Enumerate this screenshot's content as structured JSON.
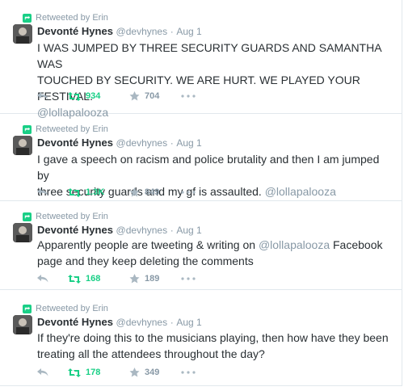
{
  "tweets": [
    {
      "retweeted_by": "Retweeted by Erin",
      "name": "Devonté Hynes",
      "handle": "@devhynes",
      "time": "Aug 1",
      "lines": [
        "I WAS JUMPED BY THREE SECURITY GUARDS AND SAMANTHA WAS",
        "TOUCHED BY SECURITY. WE ARE HURT. WE PLAYED YOUR FESTIVAL."
      ],
      "last_plain": "",
      "mention": "@lollapalooza",
      "retweets": "934",
      "favorites": "704"
    },
    {
      "retweeted_by": "Retweeted by Erin",
      "name": "Devonté Hynes",
      "handle": "@devhynes",
      "time": "Aug 1",
      "lines": [
        "I gave a speech on racism and police brutality and then I am jumped by"
      ],
      "last_plain": "three security guards and my gf is assaulted. ",
      "mention": "@lollapalooza",
      "retweets": "1.3K",
      "favorites": "849"
    },
    {
      "retweeted_by": "Retweeted by Erin",
      "name": "Devonté Hynes",
      "handle": "@devhynes",
      "time": "Aug 1",
      "line1_pre": "Apparently people are tweeting & writing on ",
      "mention": "@lollapalooza",
      "line1_post": " Facebook",
      "line2": "page and they keep deleting the comments",
      "retweets": "168",
      "favorites": "189"
    },
    {
      "retweeted_by": "Retweeted by Erin",
      "name": "Devonté Hynes",
      "handle": "@devhynes",
      "time": "Aug 1",
      "lines": [
        "If they're doing this to the musicians playing, then how have they been",
        "treating all the attendees throughout the day?"
      ],
      "retweets": "178",
      "favorites": "349"
    }
  ],
  "colors": {
    "retweet_green": "#19cf86",
    "muted": "#8899a6",
    "text": "#292f33"
  },
  "icons": {
    "retweeted_by": "retweet-icon",
    "reply": "reply-icon",
    "retweet": "retweet-icon",
    "favorite": "star-icon",
    "more": "more-icon"
  }
}
